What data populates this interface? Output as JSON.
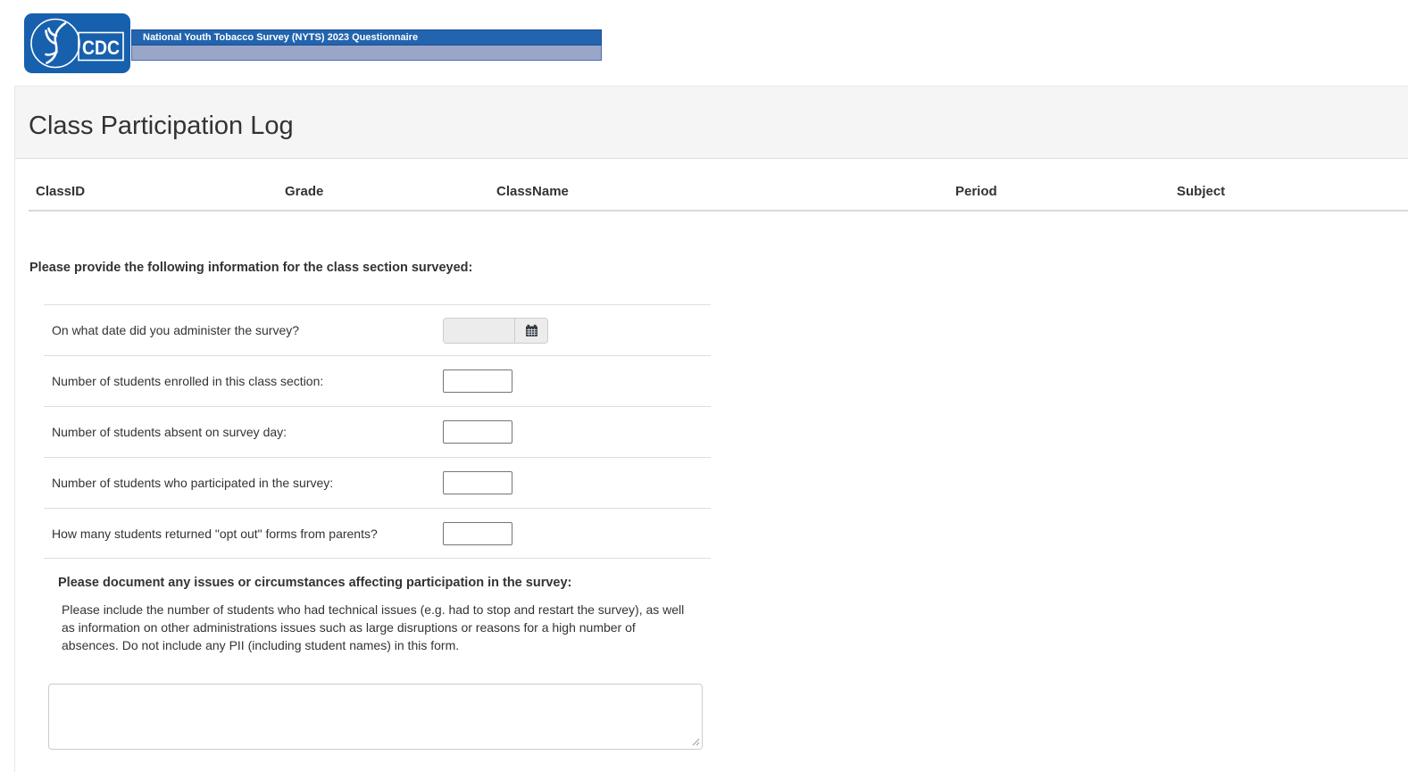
{
  "header": {
    "logo": {
      "cdc_label": "CDC"
    },
    "banner": {
      "title": "National Youth Tobacco Survey (NYTS) 2023 Questionnaire"
    }
  },
  "page": {
    "title": "Class Participation Log"
  },
  "class_table": {
    "columns": [
      "ClassID",
      "Grade",
      "ClassName",
      "Period",
      "Subject"
    ]
  },
  "form": {
    "intro": "Please provide the following information for the class section surveyed:",
    "questions": [
      {
        "label": "On what date did you administer the survey?",
        "type": "date",
        "value": "",
        "placeholder": ""
      },
      {
        "label": "Number of students enrolled in this class section:",
        "type": "number",
        "value": "",
        "placeholder": ""
      },
      {
        "label": "Number of students absent on survey day:",
        "type": "number",
        "value": "",
        "placeholder": ""
      },
      {
        "label": "Number of students who participated in the survey:",
        "type": "number",
        "value": "",
        "placeholder": ""
      },
      {
        "label": "How many students returned \"opt out\" forms from parents?",
        "type": "number",
        "value": "",
        "placeholder": ""
      }
    ],
    "issues": {
      "heading": "Please document any issues or circumstances affecting participation in the survey:",
      "instructions": "Please include the number of students who had technical issues (e.g. had to stop and restart the survey), as well as information on other administrations issues such as large disruptions or reasons for a high number of absences. Do not include any PII (including student names) in this form.",
      "textarea_value": ""
    }
  },
  "icons": {
    "calendar": "calendar-icon",
    "resize_handle": "resize-handle-icon",
    "hhs_seal": "hhs-eagle-seal-icon"
  },
  "colors": {
    "banner_blue": "#2264ae",
    "banner_light_blue": "#9aa6c7",
    "logo_blue": "#1760ae",
    "heading_bg": "#f5f5f5",
    "divider": "#dddddd",
    "text": "#333333"
  }
}
